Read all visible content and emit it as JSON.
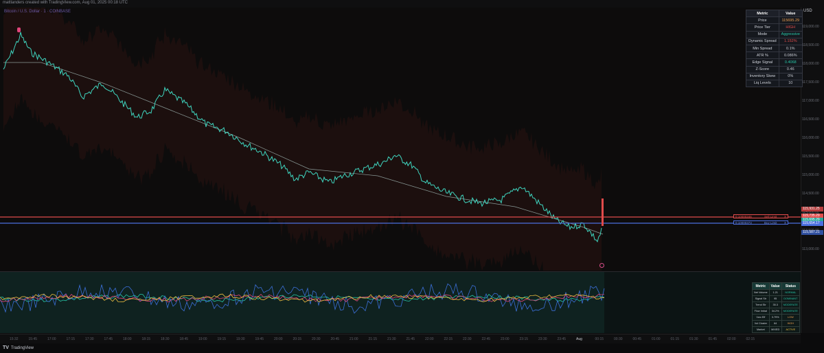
{
  "header": {
    "created_text": "mattlanders created with TradingView.com, Aug 01, 2025 00:18 UTC",
    "legend": "Bitcoin / U.S. Dollar · 1 · COINBASE"
  },
  "colors": {
    "background": "#0b0b0c",
    "price_line": "#3fd6c0",
    "ma_line": "#8a9a97",
    "sell_limit": "#e04b4b",
    "buy_limit": "#4b6fe0",
    "accent_orange": "#f0a050",
    "accent_teal": "#26c6a7"
  },
  "price_axis": {
    "currency": "USD",
    "ticks": [
      "119,000.00",
      "118,500.00",
      "118,000.00",
      "117,500.00",
      "117,000.00",
      "116,500.00",
      "116,000.00",
      "115,500.00",
      "115,000.00",
      "114,500.00",
      "114,000.00",
      "113,500.00",
      "113,000.00"
    ],
    "tags": [
      {
        "text": "115,931.25",
        "color": "#b33b3b"
      },
      {
        "text": "115,735.29",
        "color": "#e04b4b"
      },
      {
        "text": "115,695.29",
        "color": "#26a69a"
      },
      {
        "text": "115,654.17",
        "color": "#4b6fe0"
      },
      {
        "text": "115,587.21",
        "color": "#3050a0"
      }
    ]
  },
  "time_axis": {
    "ticks": [
      "15:32",
      "15:45",
      "17:00",
      "17:15",
      "17:30",
      "17:45",
      "18:00",
      "18:15",
      "18:30",
      "18:45",
      "19:00",
      "19:15",
      "19:30",
      "19:45",
      "20:00",
      "20:15",
      "20:30",
      "20:45",
      "21:00",
      "21:15",
      "21:30",
      "21:45",
      "22:00",
      "22:15",
      "22:30",
      "22:45",
      "23:00",
      "23:15",
      "23:30",
      "23:45",
      "Aug",
      "00:15",
      "00:30",
      "00:45",
      "01:00",
      "01:15",
      "01:30",
      "01:45",
      "02:00",
      "02:15"
    ]
  },
  "metric_table": {
    "headers": [
      "Metric",
      "Value"
    ],
    "rows": [
      {
        "metric": "Price",
        "value": "115695.29",
        "color": "#f0a050"
      },
      {
        "metric": "Price Tier",
        "value": "HIGH",
        "color": "#e04b4b"
      },
      {
        "metric": "Mode",
        "value": "Aggressive",
        "color": "#26c6a7"
      },
      {
        "metric": "Dynamic Spread",
        "value": "1.152%",
        "color": "#e04b4b"
      },
      {
        "metric": "Min Spread",
        "value": "0.1%",
        "color": "#c9ccd4"
      },
      {
        "metric": "ATR %",
        "value": "0.086%",
        "color": "#c9ccd4"
      },
      {
        "metric": "Edge Signal",
        "value": "0.4068",
        "color": "#26c6a7"
      },
      {
        "metric": "Z-Score",
        "value": "0.46",
        "color": "#c9ccd4"
      },
      {
        "metric": "Inventory Skew",
        "value": "0%",
        "color": "#c9ccd4"
      },
      {
        "metric": "Liq Levels",
        "value": "10",
        "color": "#c9ccd4"
      }
    ]
  },
  "status_table": {
    "headers": [
      "Metric",
      "Value",
      "Status"
    ],
    "rows": [
      {
        "metric": "Net Volume",
        "value": "1.21",
        "status": "NORMAL",
        "color": "#26c6a7"
      },
      {
        "metric": "Signal Str",
        "value": "95",
        "status": "DOMINANT",
        "color": "#26c6a7"
      },
      {
        "metric": "Trend Str",
        "value": "35.3",
        "status": "MODERATE",
        "color": "#26c6a7"
      },
      {
        "metric": "Flow Imbal",
        "value": "34.2%",
        "status": "MODERATE",
        "color": "#26c6a7"
      },
      {
        "metric": "Vwo Eff",
        "value": "3.79%",
        "status": "LOW",
        "color": "#f0a050"
      },
      {
        "metric": "Vol Cluster",
        "value": "64",
        "status": "HIGH",
        "color": "#f0a050"
      },
      {
        "metric": "Market",
        "value": "MIXED",
        "status": "ACTIVE",
        "color": "#f0c040"
      }
    ]
  },
  "orders": {
    "sell": {
      "qty": "0.10000346",
      "name": "Sell Limit",
      "close": "X"
    },
    "buy": {
      "qty": "0.10000373",
      "name": "Buy Limit",
      "close": "X"
    }
  },
  "footer": {
    "logo": "TV",
    "text": "TradingView"
  }
}
